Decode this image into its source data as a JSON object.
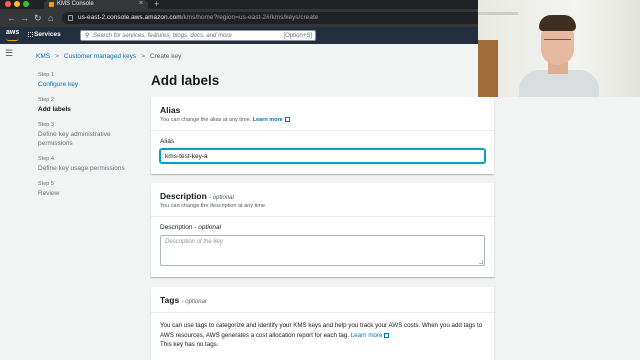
{
  "browser": {
    "tab_title": "KMS Console",
    "tab_close": "×",
    "new_tab": "+",
    "url_host": "us-east-2.console.aws.amazon.com",
    "url_path": "/kms/home?region=us-east-2#/kms/keys/create",
    "nav": {
      "back": "←",
      "forward": "→",
      "reload": "↻",
      "home": "⌂"
    }
  },
  "aws_header": {
    "logo": "aws",
    "services_label": "Services",
    "search_placeholder": "Search for services, features, blogs, docs, and more",
    "search_shortcut": "[Option+S]"
  },
  "breadcrumb": {
    "items": [
      "KMS",
      "Customer managed keys",
      "Create key"
    ],
    "separator": ">"
  },
  "page_title": "Add labels",
  "steps": [
    {
      "num": "Step 1",
      "label": "Configure key"
    },
    {
      "num": "Step 2",
      "label": "Add labels"
    },
    {
      "num": "Step 3",
      "label": "Define key administrative permissions"
    },
    {
      "num": "Step 4",
      "label": "Define key usage permissions"
    },
    {
      "num": "Step 5",
      "label": "Review"
    }
  ],
  "alias_section": {
    "title": "Alias",
    "desc": "You can change the alias at any time.",
    "learn_more": "Learn more",
    "field_label": "Alias",
    "field_value": "kms-test-key-a"
  },
  "description_section": {
    "title": "Description",
    "optional": "- optional",
    "desc": "You can change the description at any time.",
    "field_label": "Description",
    "field_optional": "- optional",
    "placeholder": "Description of the key"
  },
  "tags_section": {
    "title": "Tags",
    "optional": "- optional",
    "body": "You can use tags to categorize and identify your KMS keys and help you track your AWS costs. When you add tags to AWS resources, AWS generates a cost allocation report for each tag.",
    "learn_more": "Learn more",
    "no_tags": "This key has no tags."
  },
  "colors": {
    "aws_nav": "#232f3e",
    "accent_orange": "#ff9900",
    "link_blue": "#0073bb",
    "focus_ring": "#00a1c9"
  }
}
